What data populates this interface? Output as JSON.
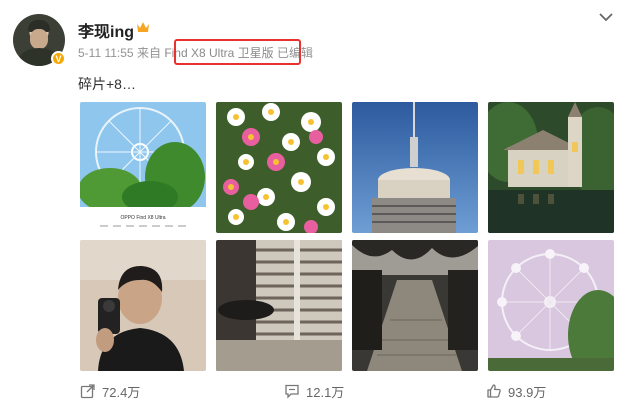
{
  "post": {
    "username": "李现ing",
    "time": "5-11 11:55",
    "from_label": "来自",
    "source": "Find X8 Ultra 卫星版",
    "edited": "已编辑",
    "text": "碎片+8…",
    "verified_badge": "V"
  },
  "photos": [
    {
      "name": "ferris-wheel-card",
      "caption": "OPPO Find X8 Ultra"
    },
    {
      "name": "daisies"
    },
    {
      "name": "tower-blue-sky"
    },
    {
      "name": "chapel-pond"
    },
    {
      "name": "selfie-mirror"
    },
    {
      "name": "window-shadows"
    },
    {
      "name": "dark-street"
    },
    {
      "name": "ferris-wheel-pink"
    }
  ],
  "actions": {
    "share_count": "72.4万",
    "comment_count": "12.1万",
    "like_count": "93.9万"
  },
  "icons": {
    "crown": "crown-icon",
    "chevron": "chevron-down-icon",
    "share": "share-icon",
    "comment": "comment-icon",
    "like": "like-icon"
  },
  "colors": {
    "highlight_box": "#e8322f",
    "verified": "#f7a800",
    "meta_text": "#939393"
  }
}
